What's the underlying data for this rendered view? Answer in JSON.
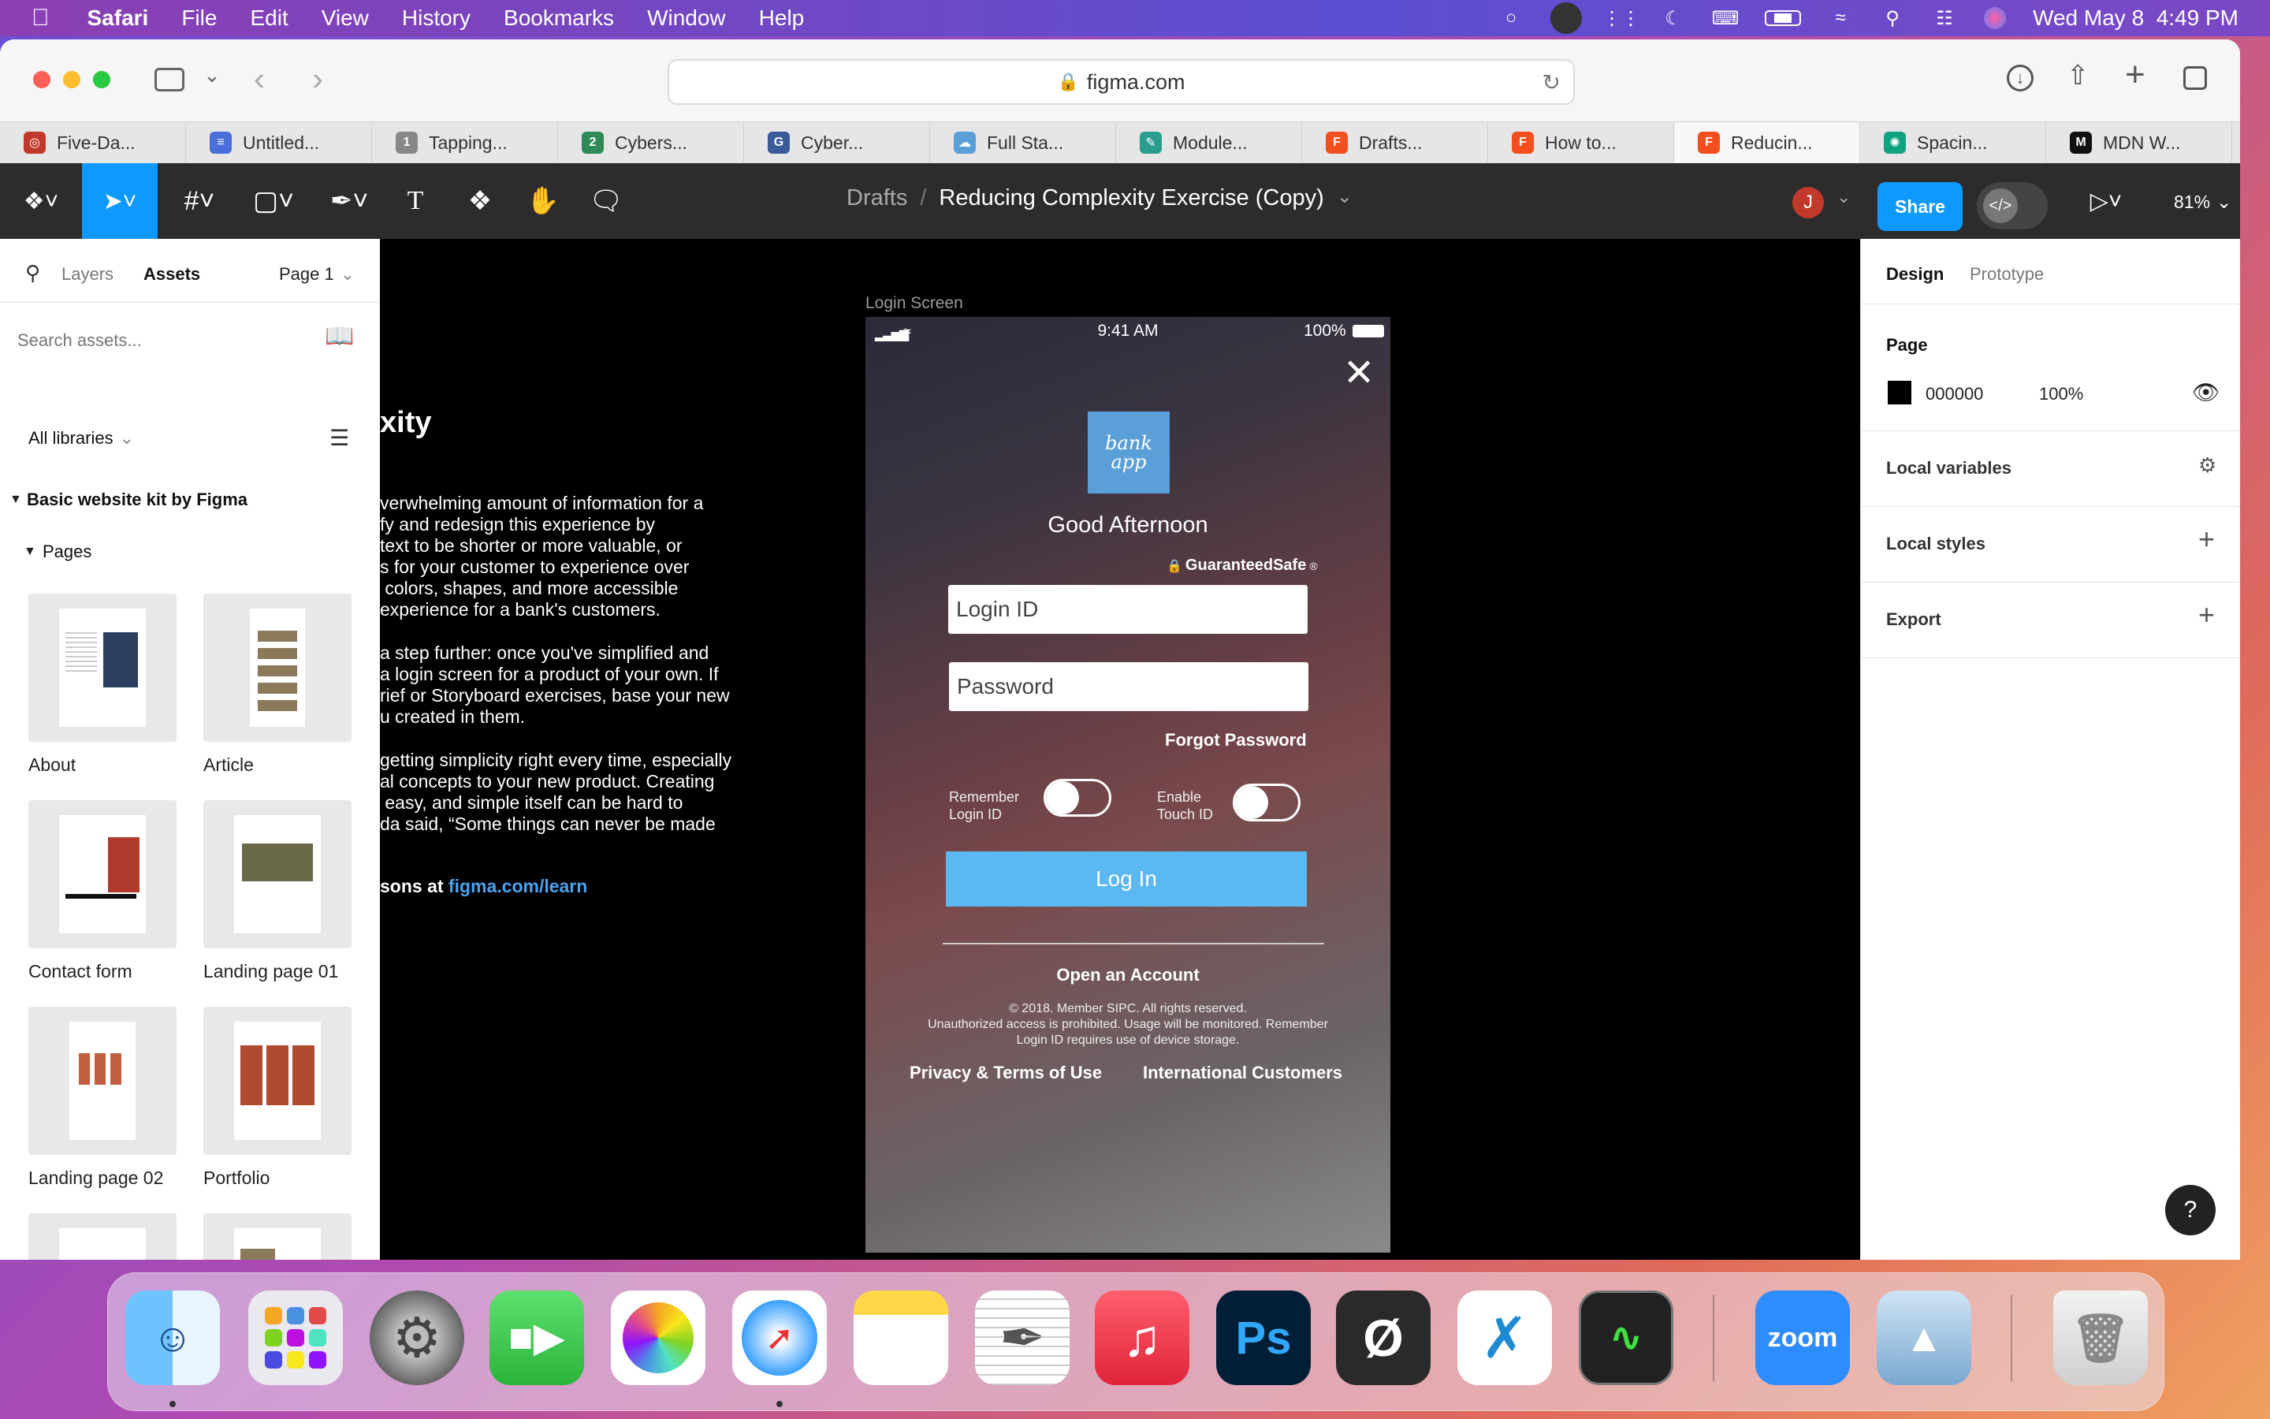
{
  "menubar": {
    "app": "Safari",
    "items": [
      "File",
      "Edit",
      "View",
      "History",
      "Bookmarks",
      "Window",
      "Help"
    ],
    "clock": "Wed May 8  4:49 PM"
  },
  "browser": {
    "url": "figma.com",
    "tabs": [
      {
        "label": "Five-Da...",
        "color": "#c0392b",
        "glyph": "◎"
      },
      {
        "label": "Untitled...",
        "color": "#4a6fd8",
        "glyph": "≡"
      },
      {
        "label": "Tapping...",
        "color": "#888888",
        "glyph": "1"
      },
      {
        "label": "Cybers...",
        "color": "#2e8b57",
        "glyph": "2"
      },
      {
        "label": "Cyber...",
        "color": "#3a5a9a",
        "glyph": "G"
      },
      {
        "label": "Full Sta...",
        "color": "#5aa0d8",
        "glyph": "☁"
      },
      {
        "label": "Module...",
        "color": "#2a9d8f",
        "glyph": "✎"
      },
      {
        "label": "Drafts...",
        "color": "#f24e1e",
        "glyph": "F"
      },
      {
        "label": "How to...",
        "color": "#f24e1e",
        "glyph": "F"
      },
      {
        "label": "Reducin...",
        "color": "#f24e1e",
        "glyph": "F"
      },
      {
        "label": "Spacin...",
        "color": "#10a37f",
        "glyph": "✺"
      },
      {
        "label": "MDN W...",
        "color": "#111111",
        "glyph": "M"
      }
    ]
  },
  "figma": {
    "breadcrumb_parent": "Drafts",
    "separator": "/",
    "file_name": "Reducing Complexity Exercise (Copy)",
    "share_label": "Share",
    "avatar_letter": "J",
    "zoom": "81%"
  },
  "left_panel": {
    "tab_layers": "Layers",
    "tab_assets": "Assets",
    "page_select": "Page 1",
    "search_placeholder": "Search assets...",
    "libraries": "All libraries",
    "library_name": "Basic website kit by Figma",
    "section": "Pages",
    "pages": [
      "About",
      "Article",
      "Contact form",
      "Landing page 01",
      "Landing page 02",
      "Portfolio"
    ]
  },
  "canvas": {
    "heading_fragment": "xity",
    "para1": [
      "verwhelming amount of information for a",
      "fy and redesign this experience by",
      "text to be shorter or more valuable, or",
      "s for your customer to experience over",
      " colors, shapes, and more accessible",
      "experience for a bank's customers."
    ],
    "para2": [
      "a step further: once you've simplified and",
      "a login screen for a product of your own. If",
      "rief or Storyboard exercises, base your new",
      "u created in them."
    ],
    "para3": [
      "getting simplicity right every time, especially",
      "al concepts to your new product. Creating",
      " easy, and simple itself can be hard to",
      "da said, “Some things can never be made"
    ],
    "learn_prefix": "sons at ",
    "learn_link": "figma.com/learn",
    "frame_label": "Login Screen"
  },
  "login": {
    "time": "9:41 AM",
    "battery": "100%",
    "logo_line1": "bank",
    "logo_line2": "app",
    "greeting": "Good Afternoon",
    "secure": "GuaranteedSafe",
    "secure_mark": "®",
    "login_placeholder": "Login ID",
    "password_placeholder": "Password",
    "forgot": "Forgot Password",
    "remember_line1": "Remember",
    "remember_line2": "Login ID",
    "touch_line1": "Enable",
    "touch_line2": "Touch ID",
    "login_button": "Log In",
    "open_account": "Open an Account",
    "legal1": "© 2018. Member SIPC. All rights reserved.",
    "legal2": "Unauthorized access is prohibited. Usage will be monitored. Remember",
    "legal3": "Login ID requires use of device storage.",
    "privacy": "Privacy & Terms of Use",
    "international": "International Customers",
    "button_color": "#5bb8f0"
  },
  "right_panel": {
    "tab_design": "Design",
    "tab_prototype": "Prototype",
    "page_title": "Page",
    "page_color": "000000",
    "page_opacity": "100%",
    "local_variables": "Local variables",
    "local_styles": "Local styles",
    "export": "Export",
    "help": "?"
  },
  "dock": {
    "apps": [
      "Finder",
      "Launchpad",
      "System Preferences",
      "FaceTime",
      "Photos",
      "Safari",
      "Notes",
      "TextEdit",
      "Music",
      "Photoshop",
      "Ø",
      "Visual Studio Code",
      "Activity Monitor",
      "zoom",
      "Preview",
      "Trash"
    ],
    "ps_label": "Ps",
    "zoom_label": "zoom"
  }
}
